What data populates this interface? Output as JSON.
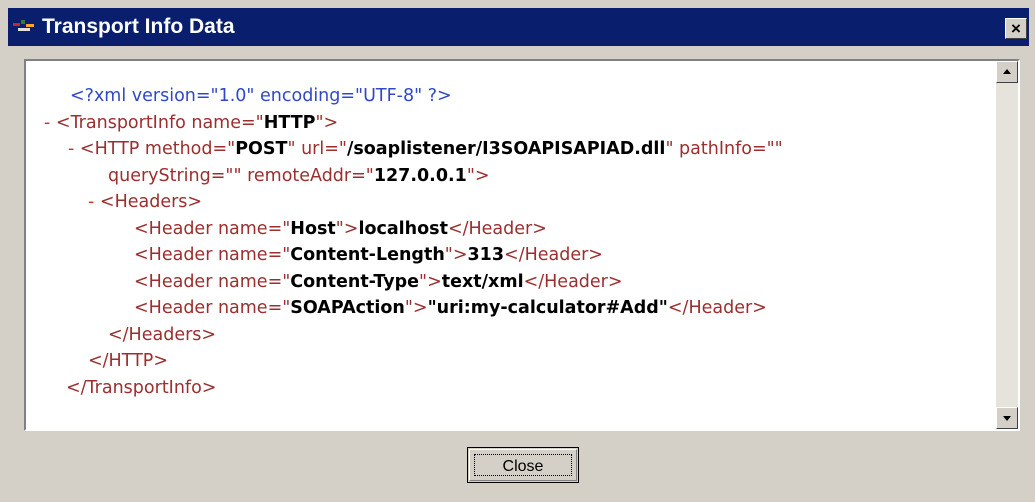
{
  "window": {
    "title": "Transport Info Data",
    "close_glyph": "×",
    "titlebar_color": "#0a1e6e"
  },
  "icons": {
    "app": "app-icon",
    "close": "close-icon",
    "scroll_up": "scroll-up-arrow-icon",
    "scroll_down": "scroll-down-arrow-icon"
  },
  "colors": {
    "tag": "#9b2e2e",
    "processing_instruction": "#3048c8",
    "values": "#000000"
  },
  "xml": {
    "decl": "<?xml version=\"1.0\" encoding=\"UTF-8\" ?>",
    "collapse_marker": "-",
    "l2_open": "<TransportInfo name=\"",
    "l2_val": "HTTP",
    "l2_close": "\">",
    "l3_open": "<HTTP method=\"",
    "l3_val1": "POST",
    "l3_mid1": "\" url=\"",
    "l3_val2": "/soaplistener/I3SOAPISAPIAD.dll",
    "l3_mid2": "\" pathInfo=\"\"",
    "l4_open": "queryString=\"\" remoteAddr=\"",
    "l4_val": "127.0.0.1",
    "l4_close": "\">",
    "l5": "<Headers>",
    "h_open": "<Header name=\"",
    "h_mid": "\">",
    "h_close": "</Header>",
    "headers": [
      {
        "name": "Host",
        "value": "localhost"
      },
      {
        "name": "Content-Length",
        "value": "313"
      },
      {
        "name": "Content-Type",
        "value": "text/xml"
      },
      {
        "name": "SOAPAction",
        "value": "\"uri:my-calculator#Add\""
      }
    ],
    "l10": "</Headers>",
    "l11": "</HTTP>",
    "l12": "</TransportInfo>"
  },
  "button": {
    "close_label": "Close"
  }
}
